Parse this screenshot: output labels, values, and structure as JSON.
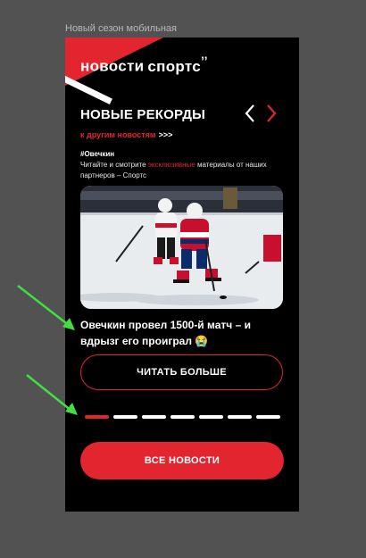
{
  "frame_label": "Новый сезон мобильная",
  "header": {
    "logo_main": "новости",
    "logo_sub": "спортс",
    "logo_mark": "’’",
    "accent_color": "#e32530"
  },
  "section": {
    "title": "НОВЫЕ РЕКОРДЫ",
    "more_link": "к другим новостям",
    "more_arrows": ">>>",
    "prev_icon": "chevron-left-icon",
    "next_icon": "chevron-right-icon"
  },
  "article": {
    "hashtag": "#Овечкин",
    "desc_before": "Читайте и смотрите",
    "desc_highlight": "эксклюзивные",
    "desc_after": "материалы от наших партнеров – Спортс",
    "headline": "Овечкин провел 1500-й матч – и вдрызг его проиграл 😭",
    "read_more": "ЧИТАТЬ БОЛЬШЕ"
  },
  "pager": {
    "total": 7,
    "active_index": 0
  },
  "all_news_button": "ВСЕ НОВОСТИ",
  "annotation_color": "#3fe03f"
}
